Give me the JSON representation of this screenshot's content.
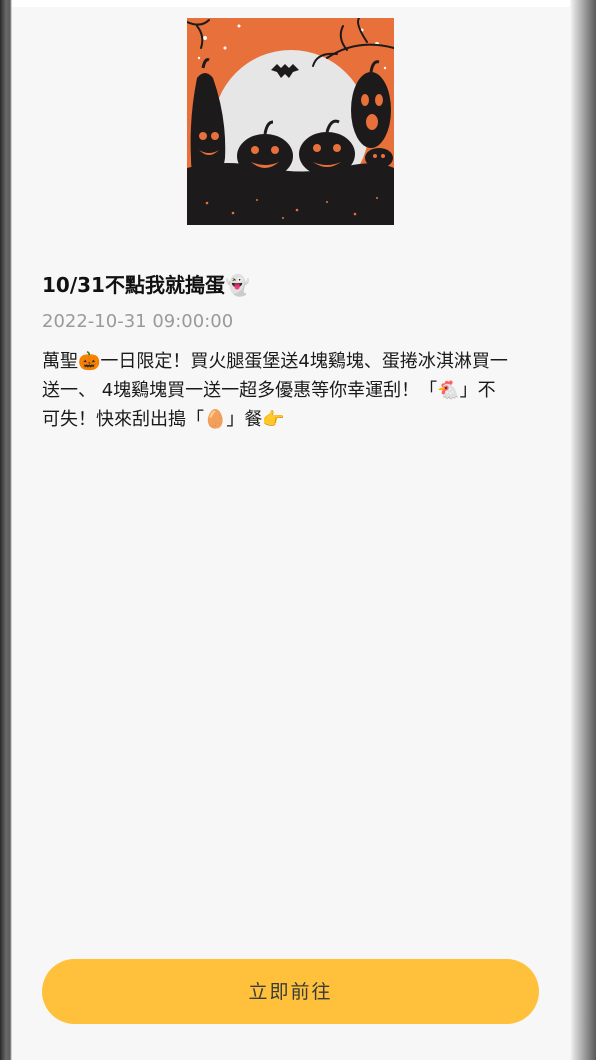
{
  "article": {
    "title": "10/31不點我就搗蛋👻",
    "date": "2022-10-31 09:00:00",
    "body_lines": [
      "萬聖🎃一日限定！買火腿蛋堡送4塊鷄塊、蛋捲冰淇淋買一",
      "送一、 4塊鷄塊買一送一超多優惠等你幸運刮！「🐔」不",
      "可失！快來刮出搗「🥚」餐👉"
    ]
  },
  "cta": {
    "label": "立即前往",
    "color": "#ffc13b"
  },
  "image": {
    "subject": "halloween-pumpkins-illustration",
    "colors": {
      "sky": "#e8703a",
      "moon": "#e6e6e6",
      "silhouette": "#1c1a1a",
      "pumpkin": "#e8703a"
    }
  }
}
